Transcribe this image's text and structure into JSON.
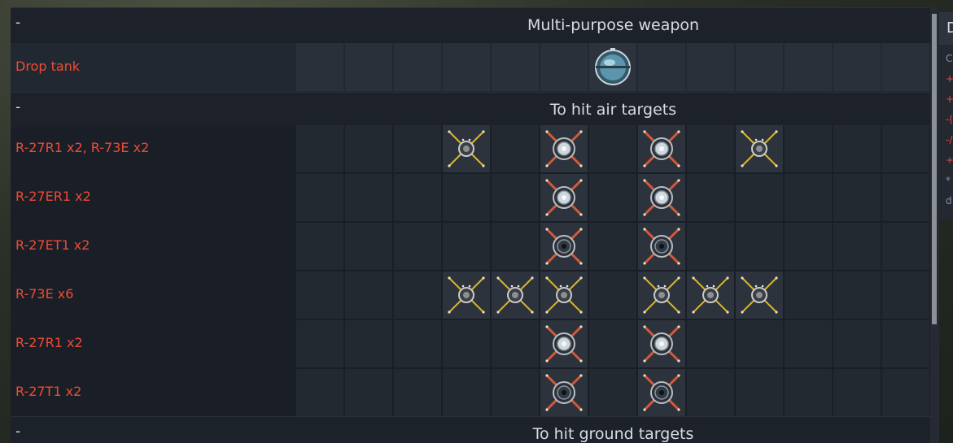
{
  "panel": {
    "sections": [
      {
        "dash": "-",
        "title": "Multi-purpose weapon"
      },
      {
        "dash": "-",
        "title": "To hit air targets"
      },
      {
        "dash": "-",
        "title": "To hit ground targets"
      }
    ],
    "drop_tank": {
      "label": "Drop tank",
      "icon": "fuel-tank-icon"
    },
    "air_loadouts": [
      {
        "label": "R-27R1 x2,  R-73E x2",
        "pylons": [
          "",
          "",
          "",
          "r73",
          "",
          "r27r",
          "",
          "r27r",
          "",
          "r73",
          "",
          "",
          ""
        ]
      },
      {
        "label": "R-27ER1 x2",
        "pylons": [
          "",
          "",
          "",
          "",
          "",
          "r27r",
          "",
          "r27r",
          "",
          "",
          "",
          "",
          ""
        ]
      },
      {
        "label": "R-27ET1 x2",
        "pylons": [
          "",
          "",
          "",
          "",
          "",
          "r27t",
          "",
          "r27t",
          "",
          "",
          "",
          "",
          ""
        ]
      },
      {
        "label": "R-73E x6",
        "pylons": [
          "",
          "",
          "",
          "r73",
          "r73",
          "r73",
          "",
          "r73",
          "r73",
          "r73",
          "",
          "",
          ""
        ]
      },
      {
        "label": "R-27R1 x2",
        "pylons": [
          "",
          "",
          "",
          "",
          "",
          "r27r",
          "",
          "r27r",
          "",
          "",
          "",
          "",
          ""
        ]
      },
      {
        "label": "R-27T1 x2",
        "pylons": [
          "",
          "",
          "",
          "",
          "",
          "r27t",
          "",
          "r27t",
          "",
          "",
          "",
          "",
          ""
        ]
      }
    ],
    "pylon_icon_names": {
      "r73": "ir-missile-icon",
      "r27r": "radar-missile-icon",
      "r27t": "ir-long-range-missile-icon"
    },
    "colors": {
      "weapon_label": "#ef4a34",
      "section_title": "#d9dde2",
      "r73_cross": "#d8b628",
      "r27_cross": "#d25a3a"
    }
  },
  "side_panel": {
    "header": "D",
    "lines": [
      {
        "text": "C",
        "color": "#8a9099"
      },
      {
        "text": "+",
        "color": "#ef4a34"
      },
      {
        "text": "+",
        "color": "#ef4a34"
      },
      {
        "text": "-(",
        "color": "#ef4a34"
      },
      {
        "text": "-/",
        "color": "#ef4a34"
      },
      {
        "text": "+",
        "color": "#ef4a34"
      },
      {
        "text": "*",
        "color": "#8a9099"
      },
      {
        "text": "d",
        "color": "#8a9099"
      }
    ]
  }
}
